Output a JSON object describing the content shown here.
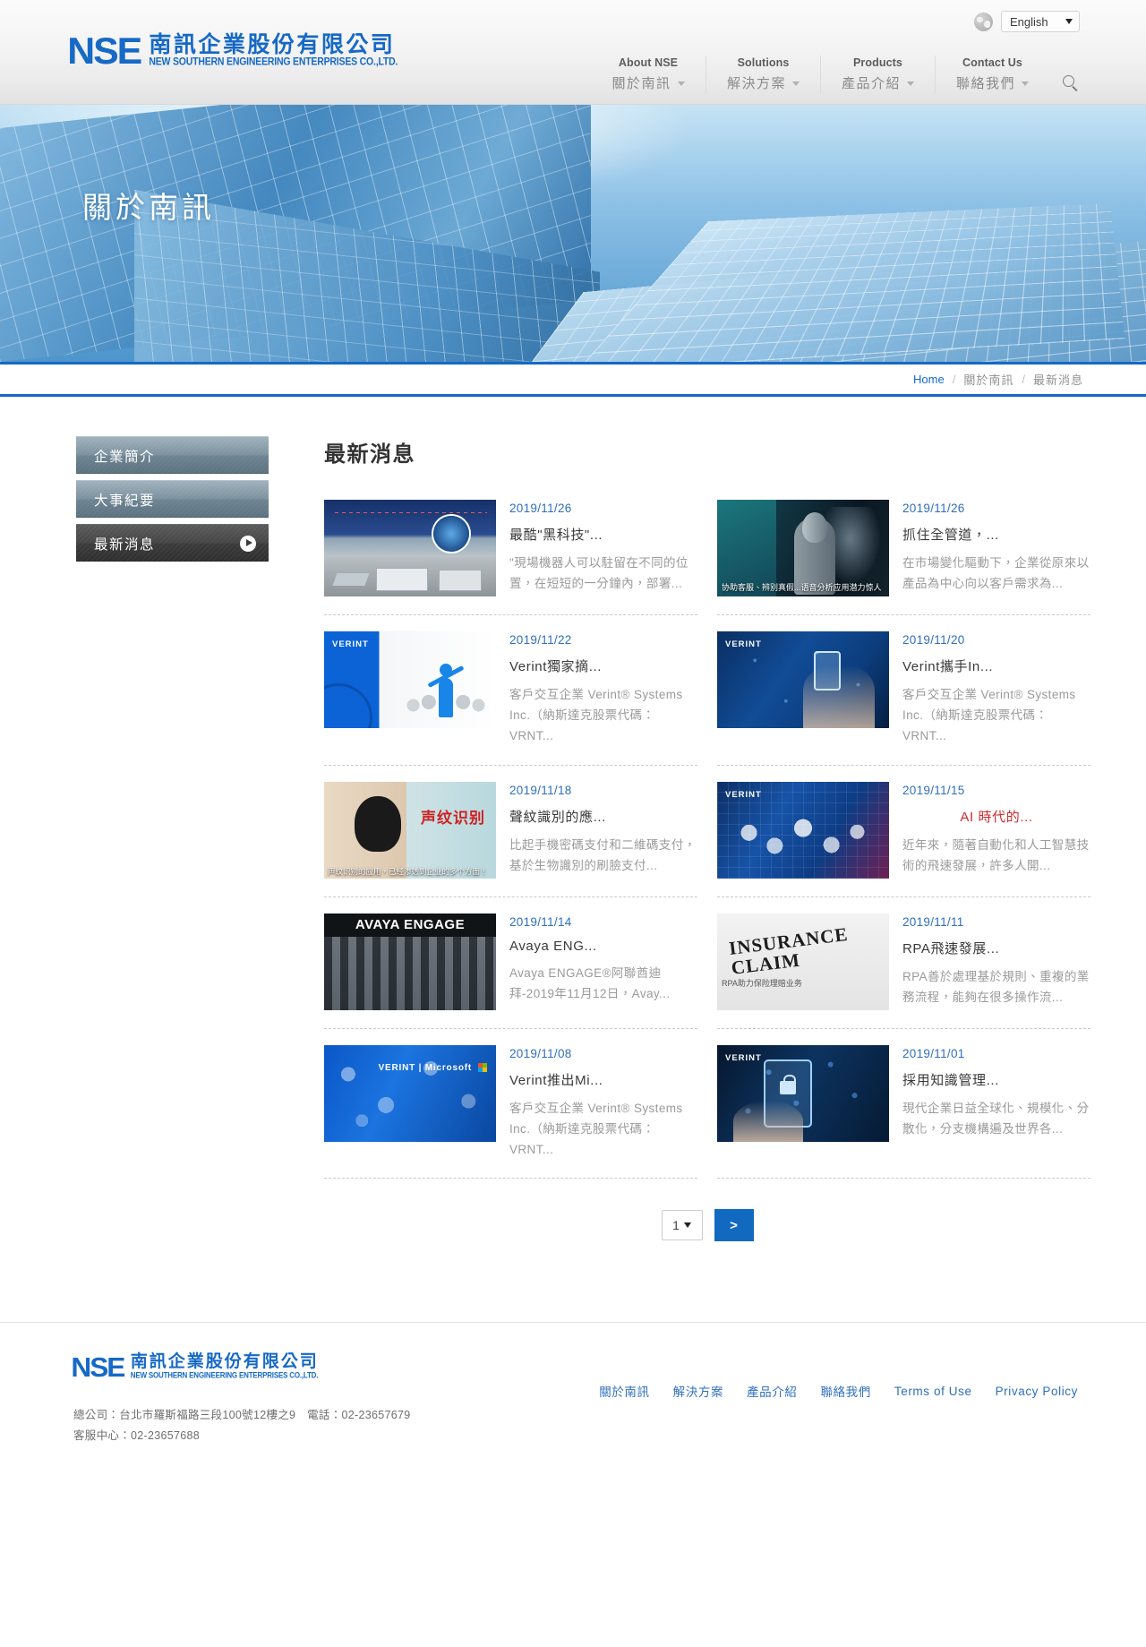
{
  "header": {
    "logo": {
      "mark": "NSE",
      "chinese": "南訊企業股份有限公司",
      "english": "NEW SOUTHERN ENGINEERING ENTERPRISES CO.,LTD."
    },
    "globe_icon": "globe-icon",
    "language": {
      "selected": "English",
      "caret": "▼"
    },
    "search_icon": "search-icon",
    "nav": [
      {
        "en": "About NSE",
        "cn": "關於南訊"
      },
      {
        "en": "Solutions",
        "cn": "解決方案"
      },
      {
        "en": "Products",
        "cn": "產品介紹"
      },
      {
        "en": "Contact Us",
        "cn": "聯絡我們"
      }
    ]
  },
  "banner": {
    "title": "關於南訊"
  },
  "breadcrumb": {
    "home": "Home",
    "sep1": "/",
    "level2": "關於南訊",
    "sep2": "/",
    "level3": "最新消息"
  },
  "sidebar": {
    "items": [
      {
        "label": "企業簡介",
        "active": false
      },
      {
        "label": "大事紀要",
        "active": false
      },
      {
        "label": "最新消息",
        "active": true
      }
    ]
  },
  "main": {
    "title": "最新消息",
    "news": [
      {
        "date": "2019/11/26",
        "title": "最酷\"黑科技\"...",
        "summary": "\"現場機器人可以駐留在不同的位置，在短短的一分鐘內，部署...",
        "thumb_caption": "",
        "thumb_badge": "",
        "title_red": false
      },
      {
        "date": "2019/11/26",
        "title": "抓住全管道，...",
        "summary": "在市場變化驅動下，企業從原來以產品為中心向以客戶需求為...",
        "thumb_caption": "协助客服、辨别真假...语音分析应用潜力惊人",
        "thumb_badge": "",
        "title_red": false
      },
      {
        "date": "2019/11/22",
        "title": "Verint獨家摘...",
        "summary": "客戶交互企業 Verint® Systems Inc.（納斯達克股票代碼：VRNT...",
        "thumb_caption": "",
        "thumb_badge": "VERINT",
        "title_red": false
      },
      {
        "date": "2019/11/20",
        "title": "Verint攜手In...",
        "summary": "客戶交互企業 Verint® Systems Inc.（納斯達克股票代碼：VRNT...",
        "thumb_caption": "",
        "thumb_badge": "VERINT",
        "title_red": false
      },
      {
        "date": "2019/11/18",
        "title": "聲紋識別的應...",
        "summary": "比起手機密碼支付和二維碼支付，基於生物識別的刷臉支付...",
        "thumb_caption": "声纹识别的应用，已经渗透到企业的多个方面！",
        "thumb_badge": "",
        "thumb_red_text": "声纹识别",
        "title_red": false
      },
      {
        "date": "2019/11/15",
        "title": "AI 時代的...",
        "summary": "近年來，隨著自動化和人工智慧技術的飛速發展，許多人開...",
        "thumb_caption": "",
        "thumb_badge": "VERINT",
        "title_red": true
      },
      {
        "date": "2019/11/14",
        "title": "Avaya ENG...",
        "summary": "Avaya ENGAGE®阿聯酋迪拜-2019年11月12日，Avay...",
        "thumb_caption": "",
        "thumb_badge": "",
        "thumb_brand": "AVAYA ENGAGE",
        "title_red": false
      },
      {
        "date": "2019/11/11",
        "title": "RPA飛速發展...",
        "summary": "RPA善於處理基於規則、重複的業務流程，能夠在很多操作流...",
        "thumb_caption": "RPA助力保险理赔业务",
        "thumb_stamp": "INSURANCE CLAIM",
        "thumb_badge": "",
        "title_red": false
      },
      {
        "date": "2019/11/08",
        "title": "Verint推出Mi...",
        "summary": "客戶交互企業 Verint® Systems Inc.（納斯達克股票代碼：VRNT...",
        "thumb_caption": "",
        "thumb_badge": "",
        "thumb_brand": "VERINT | Microsoft",
        "title_red": false
      },
      {
        "date": "2019/11/01",
        "title": "採用知識管理...",
        "summary": "現代企業日益全球化、規模化、分散化，分支機構遍及世界各...",
        "thumb_caption": "",
        "thumb_badge": "VERINT",
        "title_red": false
      }
    ],
    "pagination": {
      "current_page": "1",
      "caret": "▼",
      "next": ">"
    }
  },
  "footer": {
    "logo": {
      "mark": "NSE",
      "chinese": "南訊企業股份有限公司",
      "english": "NEW SOUTHERN ENGINEERING ENTERPRISES CO.,LTD."
    },
    "address_line1": "總公司：台北市羅斯福路三段100號12樓之9　電話：02-23657679",
    "address_line2": "客服中心：02-23657688",
    "links": [
      "關於南訊",
      "解決方案",
      "產品介紹",
      "聯絡我們",
      "Terms of Use",
      "Privacy Policy"
    ]
  },
  "colors": {
    "brand_blue": "#1669c6",
    "link_blue": "#2f6fbd",
    "accent_red": "#d0292e",
    "muted": "#9a9a9a"
  }
}
